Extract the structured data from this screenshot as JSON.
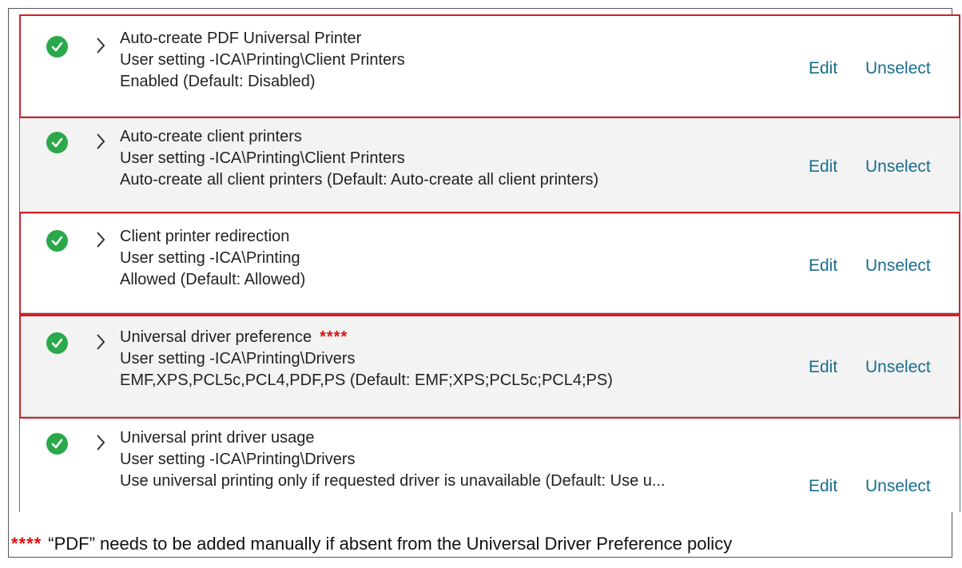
{
  "policies": [
    {
      "name": "Auto-create PDF Universal Printer",
      "setting": "User setting -ICA\\Printing\\Client Printers",
      "value": "Enabled (Default: Disabled)",
      "marker": "",
      "edit_label": "Edit",
      "unselect_label": "Unselect"
    },
    {
      "name": "Auto-create client printers",
      "setting": "User setting -ICA\\Printing\\Client Printers",
      "value": "Auto-create all client printers (Default: Auto-create all client printers)",
      "marker": "",
      "edit_label": "Edit",
      "unselect_label": "Unselect"
    },
    {
      "name": "Client printer redirection",
      "setting": "User setting -ICA\\Printing",
      "value": "Allowed (Default: Allowed)",
      "marker": "",
      "edit_label": "Edit",
      "unselect_label": "Unselect"
    },
    {
      "name": "Universal driver preference",
      "setting": "User setting -ICA\\Printing\\Drivers",
      "value": "EMF,XPS,PCL5c,PCL4,PDF,PS (Default: EMF;XPS;PCL5c;PCL4;PS)",
      "marker": "****",
      "edit_label": "Edit",
      "unselect_label": "Unselect"
    },
    {
      "name": "Universal print driver usage",
      "setting": "User setting -ICA\\Printing\\Drivers",
      "value": "Use universal printing only if requested driver is unavailable (Default: Use u...",
      "marker": "",
      "edit_label": "Edit",
      "unselect_label": "Unselect"
    }
  ],
  "footnote": {
    "marker": "****",
    "text": "“PDF” needs to be added manually if absent from the Universal Driver Preference policy"
  },
  "colors": {
    "check": "#2aa84a",
    "link": "#1a6d8e",
    "highlight": "#d3202a",
    "marker": "#e01010"
  }
}
